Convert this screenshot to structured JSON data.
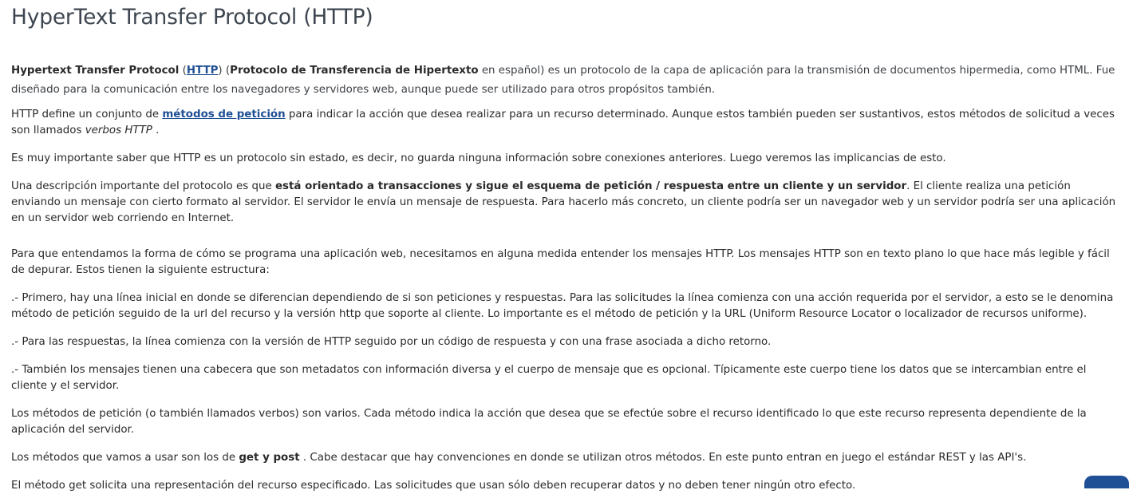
{
  "title": "HyperText Transfer Protocol (HTTP)",
  "p1": {
    "b1": "Hypertext Transfer Protocol",
    "t1": " (",
    "link": "HTTP",
    "t2": ") (",
    "b2": "Protocolo de Transferencia de Hipertexto",
    "t3": " en español) es un protocolo de la capa de aplicación para la transmisión de documentos hipermedia, como HTML. Fue diseñado para la comunicación entre los navegadores y servidores web, aunque puede ser utilizado para otros propósitos también."
  },
  "p2": {
    "t1": "HTTP define un conjunto de ",
    "link": "métodos de petición",
    "t2": " para indicar la acción que desea realizar para un recurso determinado. Aunque estos también pueden ser sustantivos, estos métodos de solicitud a veces son llamados ",
    "em": "verbos HTTP",
    "t3": " ."
  },
  "p3": "Es muy importante saber que HTTP es un protocolo sin estado, es decir, no guarda ninguna información sobre conexiones anteriores. Luego veremos las implicancias de esto.",
  "p4": {
    "t1": "Una descripción importante del protocolo es que ",
    "b": "está orientado a transacciones y sigue el esquema de petición / respuesta entre un cliente y un servidor",
    "t2": ". El cliente realiza una petición enviando un mensaje con cierto formato al servidor. El servidor le envía un mensaje de respuesta. Para hacerlo más concreto, un cliente podría ser un navegador web y un servidor podría ser una aplicación en un servidor web corriendo en Internet."
  },
  "p5": "Para que entendamos la forma de cómo se programa una aplicación web, necesitamos en alguna medida entender los mensajes HTTP. Los mensajes HTTP son en texto plano lo que hace más legible y fácil de depurar. Estos tienen la siguiente estructura:",
  "p6": ".- Primero, hay una línea inicial en donde se diferencian dependiendo de si son peticiones y respuestas. Para las solicitudes la línea comienza con una acción requerida por el servidor, a esto se le denomina método de petición seguido de la url del recurso y la versión http que soporte al cliente. Lo importante es el método de petición y la URL (Uniform Resource Locator o localizador de recursos uniforme).",
  "p7": ".- Para las respuestas, la línea comienza con la versión de HTTP seguido por un código de respuesta y con una frase asociada a dicho retorno.",
  "p8": ".- También los mensajes tienen una cabecera que son metadatos con información diversa y el cuerpo de mensaje que es opcional. Típicamente este cuerpo tiene los datos que se intercambian entre el cliente y el servidor.",
  "p9": "Los métodos de petición (o también llamados verbos) son varios. Cada método indica la acción que desea que se efectúe sobre el recurso identificado lo que este recurso representa dependiente de la aplicación del servidor.",
  "p10": {
    "t1": "Los métodos que vamos a usar son los de ",
    "b": "get y post",
    "t2": " . Cabe destacar que hay convenciones en donde se utilizan otros métodos. En este punto entran en juego el estándar REST y las API's."
  },
  "p11": "El método get solicita una representación del recurso especificado. Las solicitudes que usan sólo deben recuperar datos y no deben tener ningún otro efecto.",
  "colors": {
    "link": "#1f4f94",
    "title": "#3d4650",
    "text": "#2a2a2a"
  }
}
